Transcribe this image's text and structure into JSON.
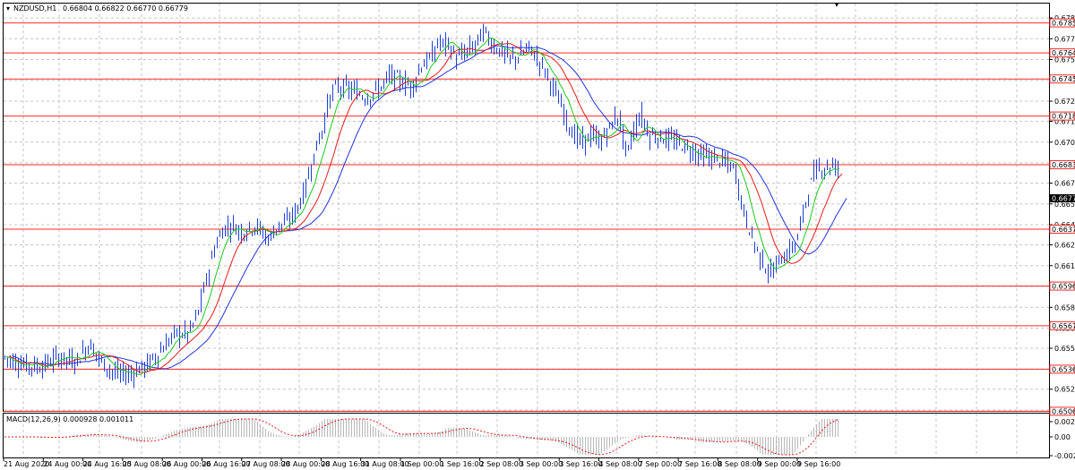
{
  "header": {
    "symbol_tf": "NZDUSD,H1",
    "ohlc": "0.66804 0.66822 0.66770 0.66779"
  },
  "macd": {
    "label": "MACD(12,26,9) 0.000928 0.001011",
    "ticks": [
      "0.00289",
      "0.00",
      "-0.00232"
    ]
  },
  "price_axis": {
    "ticks": [
      "0.67895",
      "0.67745",
      "0.67595",
      "0.67445",
      "0.67295",
      "0.67150",
      "0.67000",
      "0.66850",
      "0.66705",
      "0.66555",
      "0.66405",
      "0.66260",
      "0.66110",
      "0.65960",
      "0.65810",
      "0.65660",
      "0.65515",
      "0.65365",
      "0.65220",
      "0.65070"
    ],
    "current": "0.66779",
    "levels": [
      "0.67859",
      "0.67643",
      "0.67455",
      "0.67188",
      "0.66837",
      "0.66373",
      "0.65963",
      "0.65677",
      "0.65364",
      "0.65061"
    ]
  },
  "time_axis": {
    "labels": [
      "21 Aug 2020",
      "24 Aug 00:00",
      "24 Aug 16:00",
      "25 Aug 08:00",
      "26 Aug 00:00",
      "26 Aug 16:00",
      "27 Aug 08:00",
      "28 Aug 00:00",
      "28 Aug 16:00",
      "31 Aug 08:00",
      "1 Sep 00:00",
      "1 Sep 16:00",
      "2 Sep 08:00",
      "3 Sep 00:00",
      "3 Sep 16:00",
      "4 Sep 08:00",
      "7 Sep 00:00",
      "7 Sep 16:00",
      "8 Sep 08:00",
      "9 Sep 00:00",
      "9 Sep 16:00"
    ]
  },
  "colors": {
    "candles": "#1f3fd6",
    "level_line": "#ff2a2a",
    "ma_fast": "#1ec81e",
    "ma_mid": "#e81b1b",
    "ma_slow": "#2233dd",
    "grid": "#c4c4c4",
    "macd_signal": "#e81b1b",
    "macd_hist": "#b8b8b8"
  },
  "chart_data": {
    "type": "line",
    "title": "NZDUSD,H1",
    "x_range": [
      "21 Aug 2020",
      "10 Sep 2020"
    ],
    "ylim": [
      0.6507,
      0.67895
    ],
    "price_path": [
      [
        0,
        0.6545
      ],
      [
        20,
        0.654
      ],
      [
        40,
        0.6538
      ],
      [
        60,
        0.6545
      ],
      [
        80,
        0.6542
      ],
      [
        95,
        0.6555
      ],
      [
        110,
        0.654
      ],
      [
        125,
        0.6533
      ],
      [
        140,
        0.6533
      ],
      [
        160,
        0.654
      ],
      [
        175,
        0.655
      ],
      [
        190,
        0.6562
      ],
      [
        205,
        0.6562
      ],
      [
        215,
        0.6575
      ],
      [
        225,
        0.66
      ],
      [
        235,
        0.6625
      ],
      [
        245,
        0.6638
      ],
      [
        255,
        0.664
      ],
      [
        265,
        0.6635
      ],
      [
        280,
        0.664
      ],
      [
        295,
        0.663
      ],
      [
        305,
        0.664
      ],
      [
        315,
        0.6642
      ],
      [
        325,
        0.665
      ],
      [
        335,
        0.6665
      ],
      [
        345,
        0.669
      ],
      [
        355,
        0.671
      ],
      [
        362,
        0.673
      ],
      [
        370,
        0.674
      ],
      [
        385,
        0.6738
      ],
      [
        395,
        0.6735
      ],
      [
        405,
        0.6732
      ],
      [
        420,
        0.674
      ],
      [
        430,
        0.6748
      ],
      [
        440,
        0.6745
      ],
      [
        455,
        0.674
      ],
      [
        465,
        0.6755
      ],
      [
        475,
        0.676
      ],
      [
        485,
        0.6772
      ],
      [
        495,
        0.677
      ],
      [
        505,
        0.676
      ],
      [
        515,
        0.6765
      ],
      [
        525,
        0.677
      ],
      [
        535,
        0.678
      ],
      [
        545,
        0.677
      ],
      [
        555,
        0.6765
      ],
      [
        565,
        0.676
      ],
      [
        575,
        0.6762
      ],
      [
        585,
        0.6768
      ],
      [
        595,
        0.676
      ],
      [
        605,
        0.675
      ],
      [
        615,
        0.6735
      ],
      [
        625,
        0.672
      ],
      [
        635,
        0.6705
      ],
      [
        645,
        0.67
      ],
      [
        655,
        0.6705
      ],
      [
        665,
        0.67
      ],
      [
        675,
        0.671
      ],
      [
        685,
        0.672
      ],
      [
        695,
        0.669
      ],
      [
        700,
        0.6705
      ],
      [
        710,
        0.672
      ],
      [
        720,
        0.6705
      ],
      [
        735,
        0.6703
      ],
      [
        750,
        0.67
      ],
      [
        765,
        0.6695
      ],
      [
        780,
        0.669
      ],
      [
        795,
        0.6688
      ],
      [
        805,
        0.6685
      ],
      [
        815,
        0.668
      ],
      [
        825,
        0.665
      ],
      [
        835,
        0.663
      ],
      [
        845,
        0.6615
      ],
      [
        855,
        0.6605
      ],
      [
        865,
        0.6615
      ],
      [
        875,
        0.662
      ],
      [
        885,
        0.663
      ],
      [
        895,
        0.666
      ],
      [
        905,
        0.668
      ],
      [
        915,
        0.6682
      ],
      [
        925,
        0.6683
      ],
      [
        935,
        0.668
      ]
    ],
    "series": [
      {
        "values": "fast moving average"
      },
      {
        "values": "medium moving average"
      },
      {
        "values": "slow moving average"
      }
    ]
  }
}
